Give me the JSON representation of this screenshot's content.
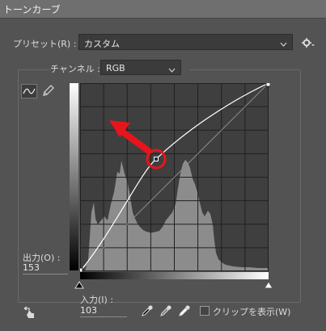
{
  "window": {
    "title": "トーンカーブ"
  },
  "preset": {
    "label": "プリセット(R) :",
    "value": "カスタム"
  },
  "channel": {
    "label": "チャンネル :",
    "value": "RGB"
  },
  "output": {
    "label": "出力(O) :",
    "value": "153"
  },
  "input": {
    "label": "入力(I) :",
    "value": "103"
  },
  "options": {
    "clip_label": "クリップを表示(W)",
    "clip_checked": false
  },
  "colors": {
    "accent_arrow": "#e8141c",
    "curve": "#ffffff",
    "grid_bg": "#3f3f3f",
    "histogram": "#8c8c8c"
  },
  "curve_editor": {
    "selected_point": {
      "input": 103,
      "output": 153
    },
    "endpoints": [
      {
        "input": 0,
        "output": 0
      },
      {
        "input": 255,
        "output": 255
      }
    ]
  },
  "icons": [
    "settings-gear-icon",
    "curve-edit-icon",
    "pencil-icon",
    "on-image-adjust-icon",
    "black-point-eyedropper-icon",
    "gray-point-eyedropper-icon",
    "white-point-eyedropper-icon"
  ]
}
